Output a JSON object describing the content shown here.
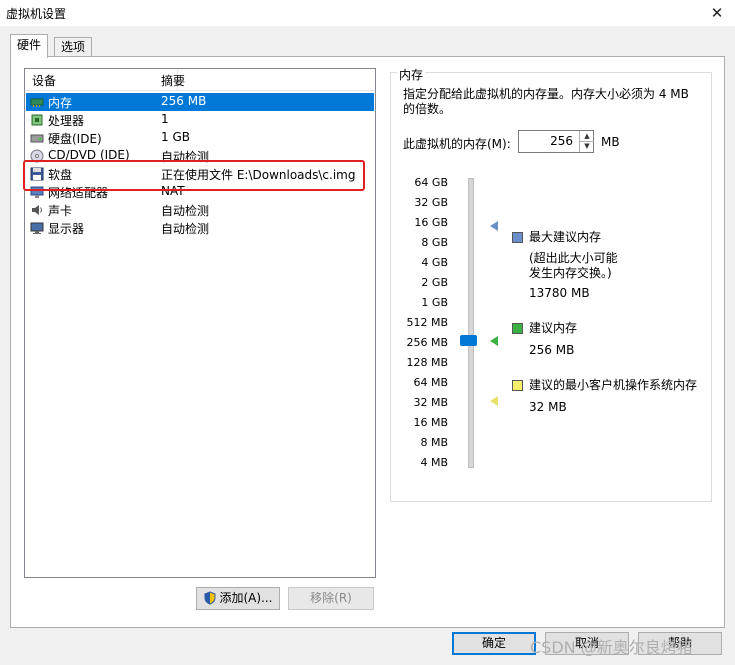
{
  "window": {
    "title": "虚拟机设置",
    "close_glyph": "✕"
  },
  "tabs": [
    {
      "label": "硬件",
      "active": true
    },
    {
      "label": "选项",
      "active": false
    }
  ],
  "device_list": {
    "columns": [
      "设备",
      "摘要"
    ],
    "rows": [
      {
        "device": "内存",
        "summary": "256 MB",
        "icon": "memory-icon",
        "selected": true
      },
      {
        "device": "处理器",
        "summary": "1",
        "icon": "processor-icon"
      },
      {
        "device": "硬盘(IDE)",
        "summary": "1 GB",
        "icon": "hard-disk-icon"
      },
      {
        "device": "CD/DVD (IDE)",
        "summary": "自动检测",
        "icon": "cd-dvd-icon"
      },
      {
        "device": "软盘",
        "summary": "正在使用文件 E:\\Downloads\\c.img",
        "icon": "floppy-icon"
      },
      {
        "device": "网络适配器",
        "summary": "NAT",
        "icon": "network-adapter-icon"
      },
      {
        "device": "声卡",
        "summary": "自动检测",
        "icon": "sound-card-icon"
      },
      {
        "device": "显示器",
        "summary": "自动检测",
        "icon": "display-icon"
      }
    ]
  },
  "list_buttons": {
    "add": "添加(A)...",
    "remove": "移除(R)",
    "add_icon": "shield-icon"
  },
  "memory": {
    "group_label": "内存",
    "description": "指定分配给此虚拟机的内存量。内存大小必须为 4 MB 的倍数。",
    "field_label": "此虚拟机的内存(M):",
    "value": "256",
    "unit": "MB",
    "ticks": [
      "64 GB",
      "32 GB",
      "16 GB",
      "8 GB",
      "4 GB",
      "2 GB",
      "1 GB",
      "512 MB",
      "256 MB",
      "128 MB",
      "64 MB",
      "32 MB",
      "16 MB",
      "8 MB",
      "4 MB"
    ],
    "legend": {
      "max_title": "最大建议内存",
      "max_note_line1": "(超出此大小可能",
      "max_note_line2": "发生内存交换。)",
      "max_value": "13780 MB",
      "rec_title": "建议内存",
      "rec_value": "256 MB",
      "min_title": "建议的最小客户机操作系统内存",
      "min_value": "32 MB"
    },
    "colors": {
      "max": "#6a8fc8",
      "recommended": "#3cb043",
      "minimum": "#f4ee6c",
      "thumb": "#0078d7"
    }
  },
  "dialog_buttons": {
    "ok": "确定",
    "cancel": "取消",
    "help": "帮助"
  },
  "watermark": "CSDN @新奥尔良烤猪",
  "colors": {
    "selection": "#0078d7",
    "highlight_box": "#e0201e"
  }
}
